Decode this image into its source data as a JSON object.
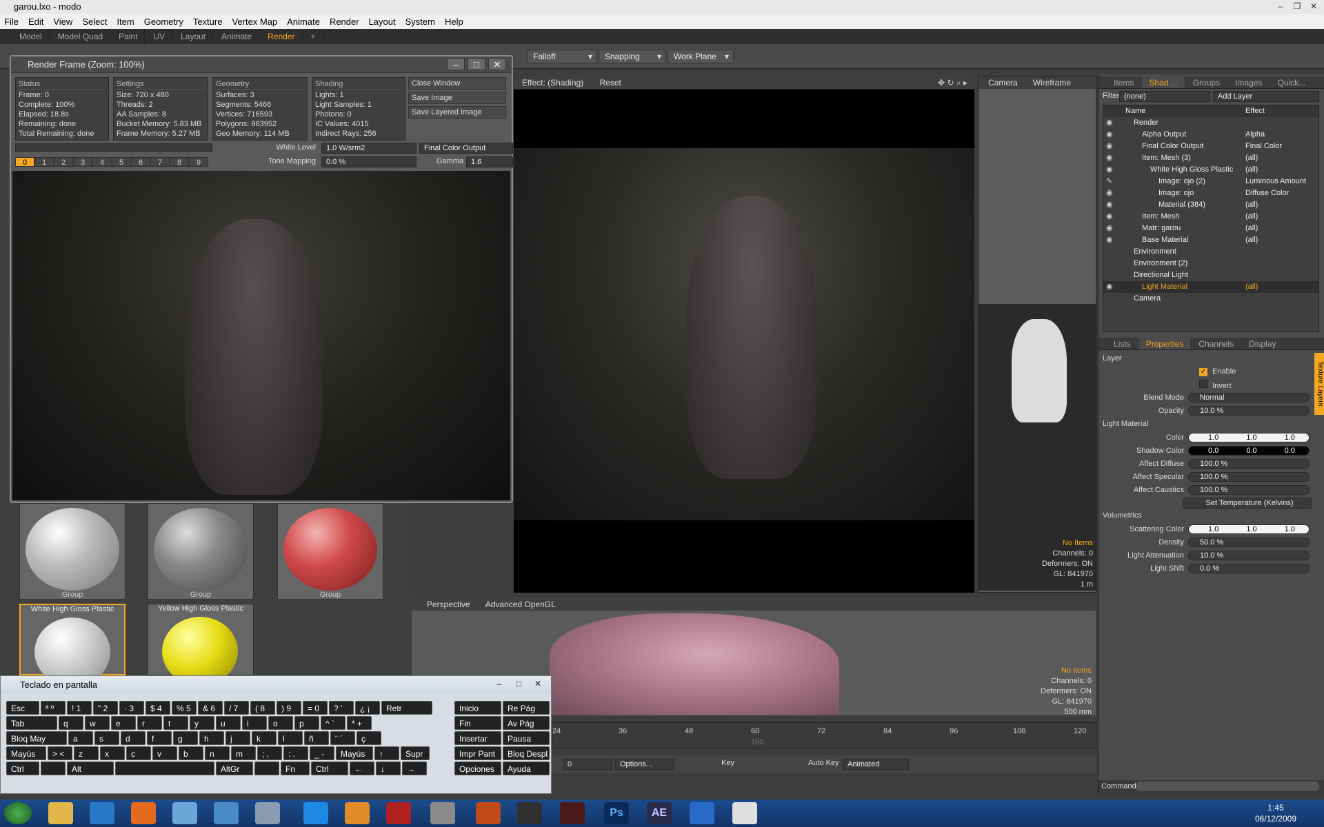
{
  "window": {
    "title": "garou.lxo - modo",
    "controls": [
      "–",
      "❐",
      "✕"
    ]
  },
  "menu": [
    "File",
    "Edit",
    "View",
    "Select",
    "Item",
    "Geometry",
    "Texture",
    "Vertex Map",
    "Animate",
    "Render",
    "Layout",
    "System",
    "Help"
  ],
  "layouts": {
    "items": [
      "Model",
      "Model Quad",
      "Paint",
      "UV",
      "Layout",
      "Animate",
      "Render"
    ],
    "active": "Render",
    "add": "+"
  },
  "toolbar": {
    "falloff": "Falloff",
    "snapping": "Snapping",
    "workplane": "Work Plane"
  },
  "main_viewport": {
    "effect": "Effect: (Shading)",
    "reset": "Reset"
  },
  "camera_viewport": {
    "tabs": [
      "Camera",
      "Wireframe"
    ],
    "info": {
      "no_items": "No Items",
      "channels": "Channels: 0",
      "deformers": "Deformers: ON",
      "gl": "GL: 841970",
      "scale": "1 m"
    }
  },
  "render_frame": {
    "title": "Render Frame (Zoom: 100%)",
    "status": {
      "header": "Status",
      "lines": [
        "Frame: 0",
        "Complete: 100%",
        "Elapsed: 18.8s",
        "Remaining: done",
        "Total Remaining: done"
      ]
    },
    "settings": {
      "header": "Settings",
      "lines": [
        "Size: 720 x 480",
        "Threads: 2",
        "AA Samples: 8",
        "Bucket Memory: 5.83 MB",
        "Frame Memory: 5.27 MB"
      ]
    },
    "geometry": {
      "header": "Geometry",
      "lines": [
        "Surfaces: 3",
        "Segments: 5466",
        "Vertices: 716593",
        "Polygons: 963952",
        "Geo Memory: 114 MB"
      ]
    },
    "shading": {
      "header": "Shading",
      "lines": [
        "Lights: 1",
        "Light Samples: 1",
        "Photons: 0",
        "IC Values: 4015",
        "Indirect Rays: 256"
      ]
    },
    "buttons": {
      "close": "Close Window",
      "save": "Save Image",
      "save_layered": "Save Layered Image"
    },
    "white_level_label": "White Level",
    "white_level": "1.0 W/srm2",
    "output": "Final Color Output",
    "tone_mapping_label": "Tone Mapping",
    "tone_mapping": "0.0 %",
    "gamma_label": "Gamma",
    "gamma": "1.6",
    "frames": [
      "0",
      "1",
      "2",
      "3",
      "4",
      "5",
      "6",
      "7",
      "8",
      "9"
    ]
  },
  "presets": {
    "group1": "Group",
    "group2": "Group",
    "group3": "Group",
    "item4": "White High Gloss Plastic",
    "item5": "Yellow High Gloss Plastic"
  },
  "shader_panel": {
    "tabs": [
      "Items",
      "Shad ...",
      "Groups",
      "Images",
      "Quick..."
    ],
    "filter_label": "Filter",
    "filter_value": "(none)",
    "add_layer": "Add Layer",
    "col_name": "Name",
    "col_effect": "Effect",
    "rows": [
      {
        "name": "Render",
        "effect": ""
      },
      {
        "name": "Alpha Output",
        "effect": "Alpha"
      },
      {
        "name": "Final Color Output",
        "effect": "Final Color"
      },
      {
        "name": "Item: Mesh (3)",
        "effect": "(all)"
      },
      {
        "name": "White High Gloss Plastic",
        "effect": "(all)"
      },
      {
        "name": "Image: ojo (2)",
        "effect": "Luminous Amount"
      },
      {
        "name": "Image: ojo",
        "effect": "Diffuse Color"
      },
      {
        "name": "Material (384)",
        "effect": "(all)"
      },
      {
        "name": "Item: Mesh",
        "effect": "(all)"
      },
      {
        "name": "Matr: garou",
        "effect": "(all)"
      },
      {
        "name": "Base Material",
        "effect": "(all)"
      },
      {
        "name": "Environment",
        "effect": ""
      },
      {
        "name": "Environment (2)",
        "effect": ""
      },
      {
        "name": "Directional Light",
        "effect": ""
      },
      {
        "name": "Light Material",
        "effect": "(all)"
      },
      {
        "name": "Camera",
        "effect": ""
      }
    ]
  },
  "properties": {
    "tabs": [
      "Lists",
      "Properties",
      "Channels",
      "Display"
    ],
    "side_tab": "Texture Layers",
    "layer_section": "Layer",
    "enable": "Enable",
    "invert": "Invert",
    "blend_mode_label": "Blend Mode",
    "blend_mode": "Normal",
    "opacity_label": "Opacity",
    "opacity": "10.0 %",
    "light_material_section": "Light Material",
    "color_label": "Color",
    "color": [
      "1.0",
      "1.0",
      "1.0"
    ],
    "shadow_color_label": "Shadow Color",
    "shadow_color": [
      "0.0",
      "0.0",
      "0.0"
    ],
    "affect_diffuse_label": "Affect Diffuse",
    "affect_diffuse": "100.0 %",
    "affect_specular_label": "Affect Specular",
    "affect_specular": "100.0 %",
    "affect_caustics_label": "Affect Caustics",
    "affect_caustics": "100.0 %",
    "set_temperature": "Set Temperature (Kelvins)",
    "volumetrics_section": "Volumetrics",
    "scattering_color_label": "Scattering Color",
    "scattering_color": [
      "1.0",
      "1.0",
      "1.0"
    ],
    "density_label": "Density",
    "density": "50.0 %",
    "light_attenuation_label": "Light Attenuation",
    "light_attenuation": "10.0 %",
    "light_shift_label": "Light Shift",
    "light_shift": "0.0 %"
  },
  "bottom_viewport": {
    "tabs": [
      "Perspective",
      "Advanced OpenGL"
    ],
    "info": {
      "no_items": "No Items",
      "channels": "Channels: 0",
      "deformers": "Deformers: ON",
      "gl": "GL: 841970",
      "scale": "500 mm"
    }
  },
  "timeline": {
    "ticks": [
      "24",
      "36",
      "48",
      "60",
      "72",
      "84",
      "96",
      "108",
      "120"
    ],
    "marker": "160"
  },
  "transport": {
    "frame": "0",
    "options": "Options...",
    "key": "Key",
    "auto_key": "Auto Key",
    "mode": "Animated"
  },
  "command_label": "Command",
  "osk": {
    "title": "Teclado en pantalla",
    "keys": [
      [
        "Esc",
        "ª º",
        "! 1",
        "\" 2",
        "· 3",
        "$ 4",
        "% 5",
        "& 6",
        "/ 7",
        "( 8",
        ") 9",
        "= 0",
        "? '",
        "¿ ¡",
        "Retr"
      ],
      [
        "Tab",
        "q",
        "w",
        "e",
        "r",
        "t",
        "y",
        "u",
        "i",
        "o",
        "p",
        "^ `",
        "* +"
      ],
      [
        "Bloq May",
        "a",
        "s",
        "d",
        "f",
        "g",
        "h",
        "j",
        "k",
        "l",
        "ñ",
        "¨ ´",
        "ç"
      ],
      [
        "Mayús",
        "> <",
        "z",
        "x",
        "c",
        "v",
        "b",
        "n",
        "m",
        "; ,",
        ": .",
        "_ -",
        "Mayús",
        "↑",
        "Supr"
      ],
      [
        "Ctrl",
        "",
        "Alt",
        "",
        "AltGr",
        "",
        "Fn",
        "Ctrl",
        "←",
        "↓",
        "→"
      ]
    ],
    "nav": [
      [
        "Inicio",
        "Re Pág"
      ],
      [
        "Fin",
        "Av Pág"
      ],
      [
        "Insertar",
        "Pausa"
      ],
      [
        "Impr Pant",
        "Bloq Despl"
      ],
      [
        "Opciones",
        "Ayuda"
      ]
    ]
  },
  "taskbar": {
    "time": "1:45",
    "date": "06/12/2009",
    "apps": [
      "Ps",
      "AE"
    ]
  }
}
